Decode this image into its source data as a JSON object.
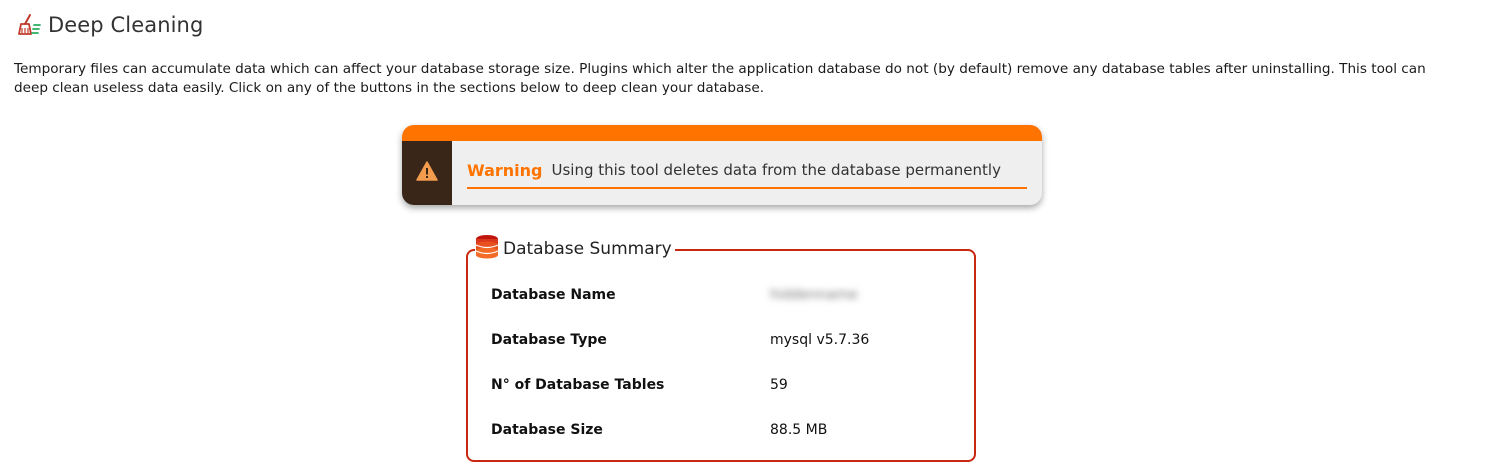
{
  "header": {
    "title": "Deep Cleaning",
    "icon": "broom-icon"
  },
  "description": "Temporary files can accumulate data which can affect your database storage size. Plugins which alter the application database do not (by default) remove any database tables after uninstalling. This tool can deep clean useless data easily. Click on any of the buttons in the sections below to deep clean your database.",
  "warning": {
    "label": "Warning",
    "message": "Using this tool deletes data from the database permanently",
    "icon": "warning-triangle-icon",
    "colors": {
      "accent": "#ff7300",
      "side": "#3a2619",
      "background": "#efefef"
    }
  },
  "database_summary": {
    "legend": "Database Summary",
    "icon": "database-icon",
    "border_color": "#c8280f",
    "rows": [
      {
        "key": "Database Name",
        "value": "hiddenname"
      },
      {
        "key": "Database Type",
        "value": "mysql v5.7.36"
      },
      {
        "key": "N° of Database Tables",
        "value": "59"
      },
      {
        "key": "Database Size",
        "value": "88.5 MB"
      }
    ]
  }
}
